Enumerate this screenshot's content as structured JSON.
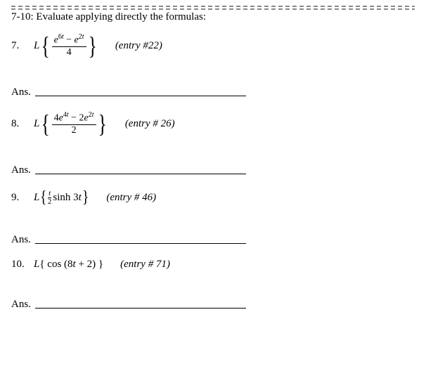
{
  "heading": "7-10: Evaluate applying directly the formulas:",
  "problems": [
    {
      "num": "7.",
      "L": "L",
      "frac_num": "e⁶ᵗ − e²ᵗ",
      "frac_den": "4",
      "entry": "(entry #22)"
    },
    {
      "num": "8.",
      "L": "L",
      "frac_num": "4e⁴ᵗ − 2e²ᵗ",
      "frac_den": "2",
      "entry": "(entry # 26)"
    },
    {
      "num": "9.",
      "L": "L",
      "t_over_2_num": "t",
      "t_over_2_den": "2",
      "sinh": "sinh 3t",
      "entry": "(entry # 46)"
    },
    {
      "num": "10.",
      "L": "L",
      "expr_plain": "{ cos (8t + 2) }",
      "entry": "(entry # 71)"
    }
  ],
  "ans_label": "Ans."
}
